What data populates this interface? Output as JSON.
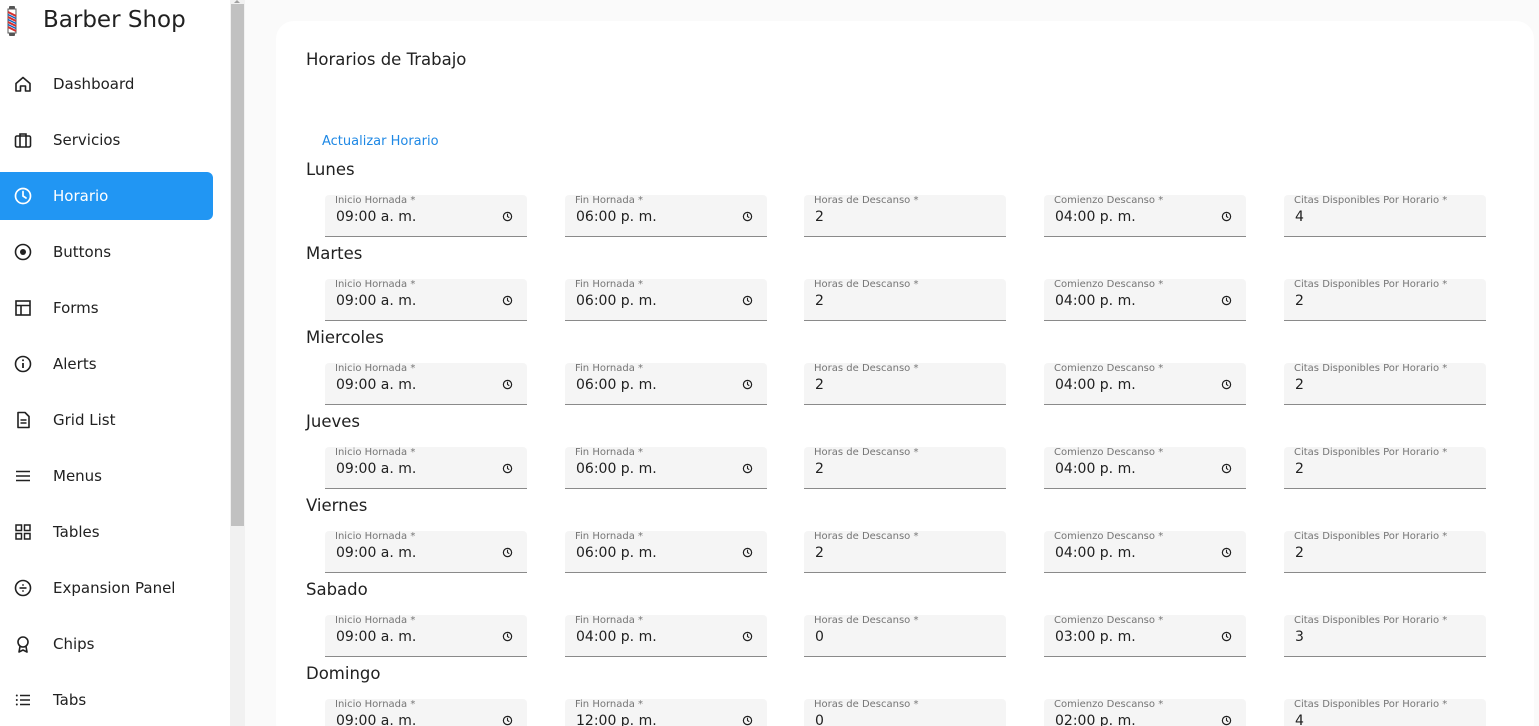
{
  "app": {
    "title": "Barber Shop"
  },
  "sidebar": {
    "items": [
      {
        "label": "Dashboard",
        "icon": "home-icon"
      },
      {
        "label": "Servicios",
        "icon": "briefcase-icon"
      },
      {
        "label": "Horario",
        "icon": "clock-icon",
        "active": true
      },
      {
        "label": "Buttons",
        "icon": "radio-button-icon"
      },
      {
        "label": "Forms",
        "icon": "layout-icon"
      },
      {
        "label": "Alerts",
        "icon": "info-icon"
      },
      {
        "label": "Grid List",
        "icon": "document-icon"
      },
      {
        "label": "Menus",
        "icon": "menu-icon"
      },
      {
        "label": "Tables",
        "icon": "grid-icon"
      },
      {
        "label": "Expansion Panel",
        "icon": "divide-icon"
      },
      {
        "label": "Chips",
        "icon": "award-icon"
      },
      {
        "label": "Tabs",
        "icon": "list-icon"
      }
    ],
    "accent": "#2196f3"
  },
  "main": {
    "title": "Horarios de Trabajo",
    "update_label": "Actualizar Horario",
    "field_labels": {
      "start": "Inicio Hornada *",
      "end": "Fin Hornada *",
      "break_hours": "Horas de Descanso *",
      "break_start": "Comienzo Descanso *",
      "slots": "Citas Disponibles Por Horario *"
    },
    "days": [
      {
        "name": "Lunes",
        "start": "09:00 a. m.",
        "end": "06:00 p. m.",
        "break_hours": "2",
        "break_start": "04:00 p. m.",
        "slots": "4"
      },
      {
        "name": "Martes",
        "start": "09:00 a. m.",
        "end": "06:00 p. m.",
        "break_hours": "2",
        "break_start": "04:00 p. m.",
        "slots": "2"
      },
      {
        "name": "Miercoles",
        "start": "09:00 a. m.",
        "end": "06:00 p. m.",
        "break_hours": "2",
        "break_start": "04:00 p. m.",
        "slots": "2"
      },
      {
        "name": "Jueves",
        "start": "09:00 a. m.",
        "end": "06:00 p. m.",
        "break_hours": "2",
        "break_start": "04:00 p. m.",
        "slots": "2"
      },
      {
        "name": "Viernes",
        "start": "09:00 a. m.",
        "end": "06:00 p. m.",
        "break_hours": "2",
        "break_start": "04:00 p. m.",
        "slots": "2"
      },
      {
        "name": "Sabado",
        "start": "09:00 a. m.",
        "end": "04:00 p. m.",
        "break_hours": "0",
        "break_start": "03:00 p. m.",
        "slots": "3"
      },
      {
        "name": "Domingo",
        "start": "09:00 a. m.",
        "end": "12:00 p. m.",
        "break_hours": "0",
        "break_start": "02:00 p. m.",
        "slots": "4"
      }
    ]
  }
}
